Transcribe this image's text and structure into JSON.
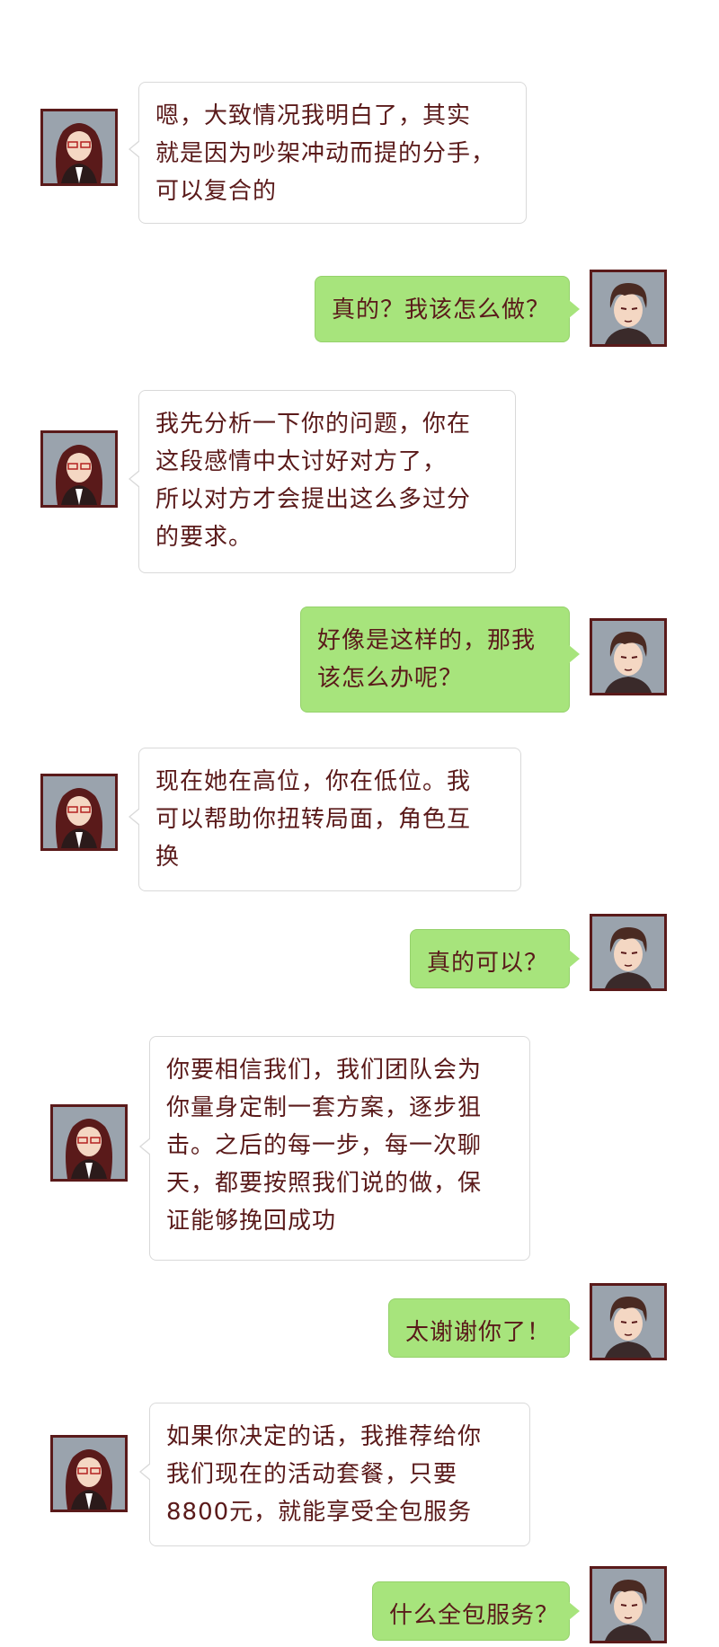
{
  "messages": [
    {
      "side": "left",
      "lines": [
        "嗯，大致情况我明白了，其实",
        "就是因为吵架冲动而提的分手，",
        "可以复合的"
      ]
    },
    {
      "side": "right",
      "lines": [
        "真的？我该怎么做？"
      ]
    },
    {
      "side": "left",
      "lines": [
        "我先分析一下你的问题，你在",
        "这段感情中太讨好对方了，",
        "所以对方才会提出这么多过分",
        "的要求。"
      ]
    },
    {
      "side": "right",
      "lines": [
        "好像是这样的，那我",
        "该怎么办呢？"
      ]
    },
    {
      "side": "left",
      "lines": [
        "现在她在高位，你在低位。我",
        "可以帮助你扭转局面，角色互",
        "换"
      ]
    },
    {
      "side": "right",
      "lines": [
        "真的可以？"
      ]
    },
    {
      "side": "left",
      "lines": [
        "你要相信我们，我们团队会为",
        "你量身定制一套方案，逐步狙",
        "击。之后的每一步，每一次聊",
        "天，都要按照我们说的做，保",
        "证能够挽回成功"
      ]
    },
    {
      "side": "right",
      "lines": [
        "太谢谢你了！"
      ]
    },
    {
      "side": "left",
      "lines": [
        "如果你决定的话，我推荐给你",
        "我们现在的活动套餐，只要",
        "8800元，就能享受全包服务"
      ]
    },
    {
      "side": "right",
      "lines": [
        "什么全包服务？"
      ]
    }
  ],
  "avatars": {
    "left": "consultant-woman-glasses-avatar",
    "right": "client-man-avatar"
  },
  "colors": {
    "text": "#5a1a1a",
    "right_bubble": "#a7e47c",
    "left_bubble": "#ffffff",
    "avatar_border": "#5a1a1a"
  }
}
